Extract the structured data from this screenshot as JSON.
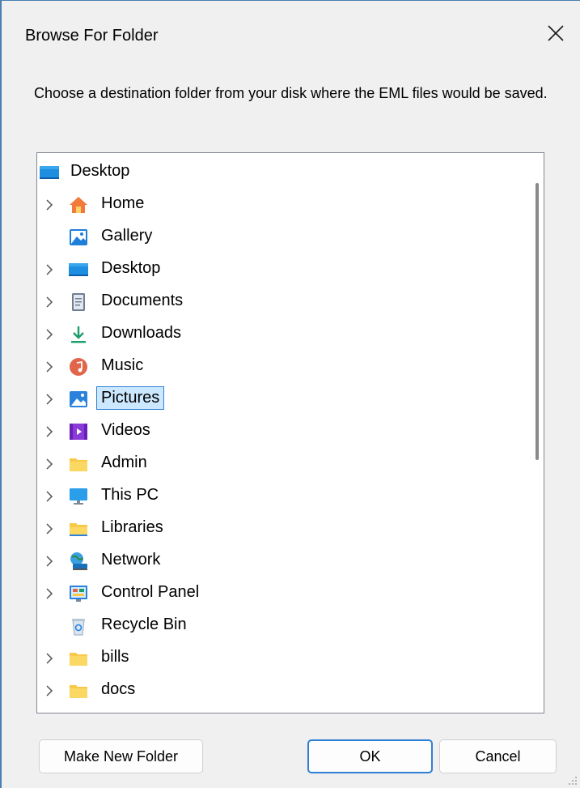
{
  "window": {
    "title": "Browse For Folder",
    "close_icon": "close-icon"
  },
  "instructions": "Choose a destination folder from your disk where the EML files would be saved.",
  "tree": {
    "items": [
      {
        "label": "Desktop",
        "icon": "desktop-icon",
        "expandable": false,
        "level": 0
      },
      {
        "label": "Home",
        "icon": "home-icon",
        "expandable": true,
        "level": 1
      },
      {
        "label": "Gallery",
        "icon": "gallery-icon",
        "expandable": false,
        "level": 1
      },
      {
        "label": "Desktop",
        "icon": "desktop-icon",
        "expandable": true,
        "level": 1
      },
      {
        "label": "Documents",
        "icon": "documents-icon",
        "expandable": true,
        "level": 1
      },
      {
        "label": "Downloads",
        "icon": "downloads-icon",
        "expandable": true,
        "level": 1
      },
      {
        "label": "Music",
        "icon": "music-icon",
        "expandable": true,
        "level": 1
      },
      {
        "label": "Pictures",
        "icon": "pictures-icon",
        "expandable": true,
        "level": 1,
        "selected": true
      },
      {
        "label": "Videos",
        "icon": "videos-icon",
        "expandable": true,
        "level": 1
      },
      {
        "label": "Admin",
        "icon": "folder-icon",
        "expandable": true,
        "level": 1
      },
      {
        "label": "This PC",
        "icon": "this-pc-icon",
        "expandable": true,
        "level": 1
      },
      {
        "label": "Libraries",
        "icon": "libraries-icon",
        "expandable": true,
        "level": 1
      },
      {
        "label": "Network",
        "icon": "network-icon",
        "expandable": true,
        "level": 1
      },
      {
        "label": "Control Panel",
        "icon": "control-panel-icon",
        "expandable": true,
        "level": 1
      },
      {
        "label": "Recycle Bin",
        "icon": "recycle-bin-icon",
        "expandable": false,
        "level": 1
      },
      {
        "label": "bills",
        "icon": "folder-icon",
        "expandable": true,
        "level": 1
      },
      {
        "label": "docs",
        "icon": "folder-icon",
        "expandable": true,
        "level": 1
      }
    ]
  },
  "buttons": {
    "make_new_folder": "Make New Folder",
    "ok": "OK",
    "cancel": "Cancel"
  },
  "colors": {
    "selection_bg": "#cce8ff",
    "selection_border": "#2f7fd5",
    "folder_yellow": "#f8c948",
    "accent_blue": "#2f7fd5"
  }
}
